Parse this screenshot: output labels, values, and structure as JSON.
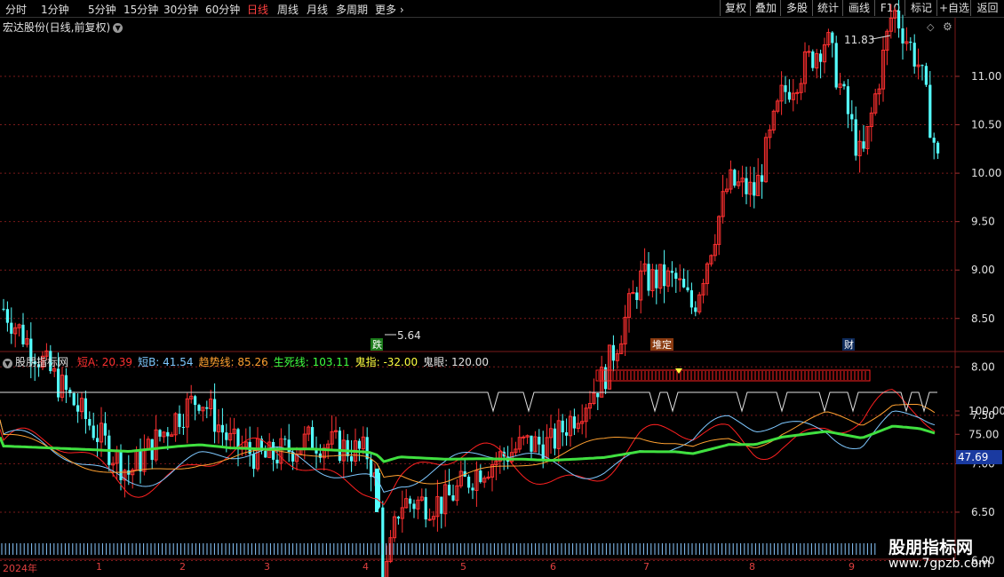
{
  "toolbar": {
    "periods": [
      "分时",
      "1分钟",
      "5分钟",
      "15分钟",
      "30分钟",
      "60分钟",
      "日线",
      "周线",
      "月线",
      "多周期",
      "更多"
    ],
    "active_period": "日线",
    "right_buttons": [
      "复权",
      "叠加",
      "多股",
      "统计",
      "画线",
      "F10",
      "标记",
      "+自选",
      "返回"
    ]
  },
  "stock_title": "宏达股份(日线,前复权)",
  "price_axis": [
    "11.00",
    "10.50",
    "10.00",
    "9.50",
    "9.00",
    "8.50",
    "8.00",
    "7.50",
    "7.00",
    "6.50",
    "6.00"
  ],
  "price_range": [
    5.5,
    12.0
  ],
  "annotations": {
    "high": "11.83",
    "low": "5.64",
    "tag_die": "跌",
    "tag_duiding": "堆定",
    "tag_cai": "财"
  },
  "indicator": {
    "name": "股朋指标网",
    "values": [
      {
        "label": "短A: 20.39",
        "color": "#ff3030"
      },
      {
        "label": "短B: 41.54",
        "color": "#7ec8ff"
      },
      {
        "label": "趋势线: 85.26",
        "color": "#ffa030"
      },
      {
        "label": "生死线: 103.11",
        "color": "#40ff40"
      },
      {
        "label": "鬼指: -32.00",
        "color": "#ffff40"
      },
      {
        "label": "鬼眼: 120.00",
        "color": "#e0e0e0"
      }
    ]
  },
  "indicator_axis": [
    "100.00",
    "75.00"
  ],
  "indicator_current": "47.69",
  "months": [
    "2024年",
    "1",
    "2",
    "3",
    "4",
    "5",
    "6",
    "7",
    "8",
    "9"
  ],
  "watermark": {
    "text": "股朋指标网",
    "url": "www.7gpzb.com"
  },
  "colors": {
    "up": "#ff3030",
    "down": "#54ffff",
    "grid": "#7a1a1a",
    "axis_text": "#e0e0e0"
  }
}
